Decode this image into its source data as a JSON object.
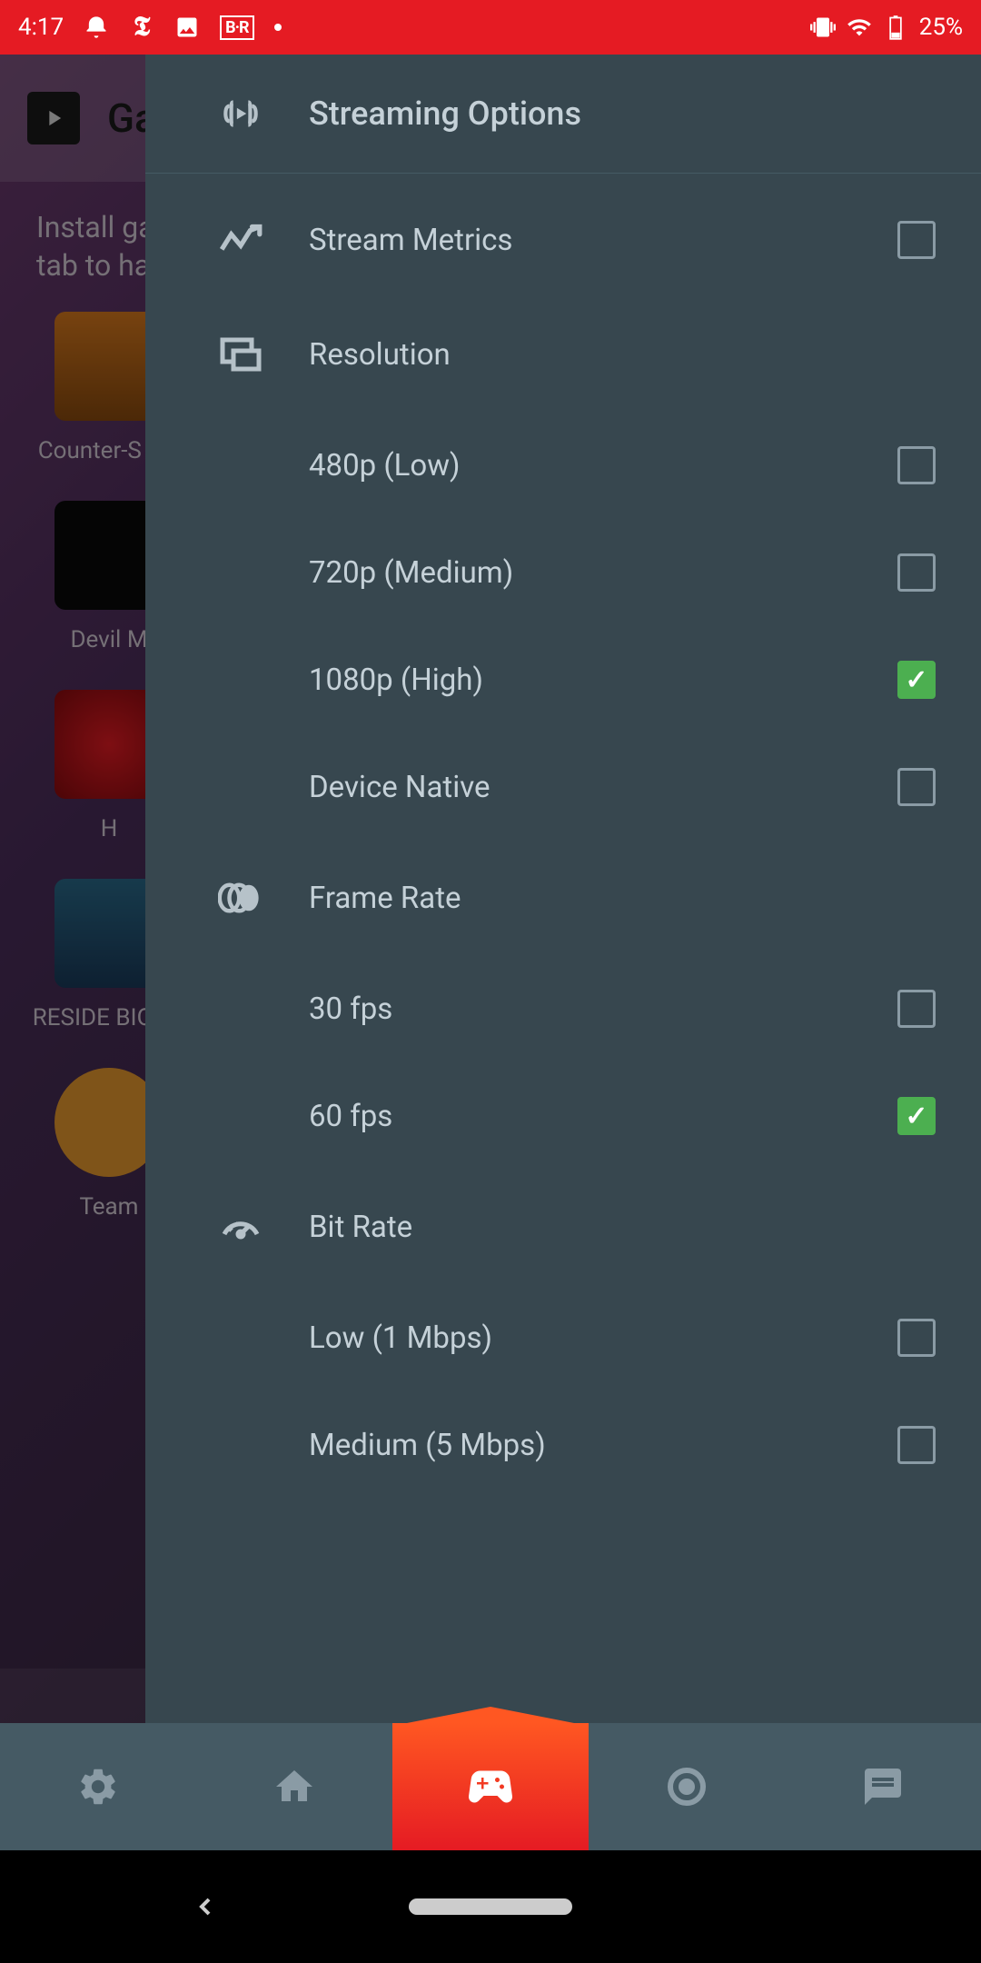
{
  "status": {
    "time": "4:17",
    "battery": "25%"
  },
  "bg_app": {
    "title": "Ga",
    "hint_line1": "Install ga",
    "hint_line2": "tab to ha",
    "games": [
      {
        "title": "Counter-S\nOff"
      },
      {
        "title": "Devil M"
      },
      {
        "title": "H"
      },
      {
        "title": "RESIDE\nBIOHA"
      },
      {
        "title": "Team"
      }
    ]
  },
  "drawer": {
    "title": "Streaming Options",
    "stream_metrics": {
      "label": "Stream Metrics",
      "checked": false
    },
    "resolution": {
      "label": "Resolution",
      "options": [
        {
          "label": "480p (Low)",
          "checked": false
        },
        {
          "label": "720p (Medium)",
          "checked": false
        },
        {
          "label": "1080p (High)",
          "checked": true
        },
        {
          "label": "Device Native",
          "checked": false
        }
      ]
    },
    "frame_rate": {
      "label": "Frame Rate",
      "options": [
        {
          "label": "30 fps",
          "checked": false
        },
        {
          "label": "60 fps",
          "checked": true
        }
      ]
    },
    "bit_rate": {
      "label": "Bit Rate",
      "options": [
        {
          "label": "Low (1 Mbps)",
          "checked": false
        },
        {
          "label": "Medium (5 Mbps)",
          "checked": false
        }
      ]
    }
  }
}
